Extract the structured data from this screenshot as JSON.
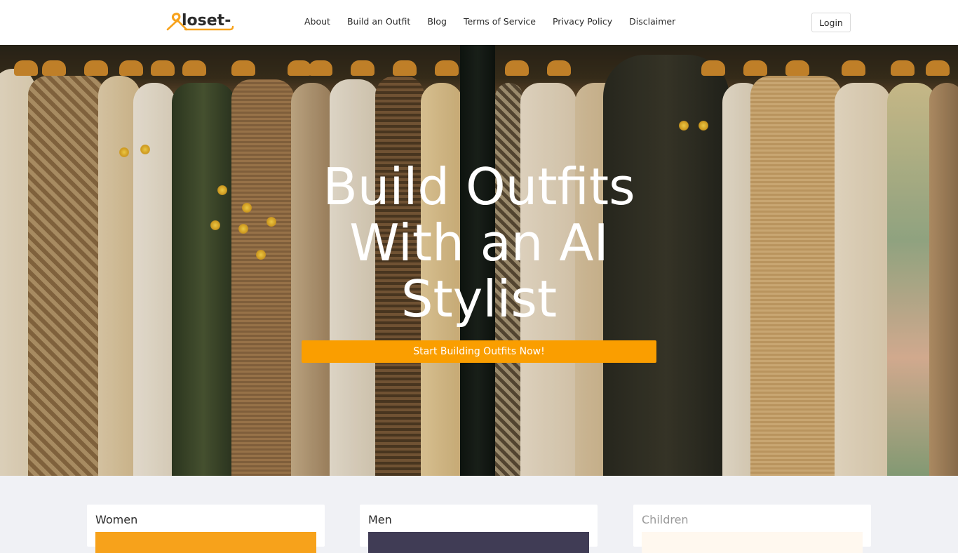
{
  "brand": {
    "logo_text": "loset-",
    "accent": "#f7a21b"
  },
  "nav": {
    "links": [
      {
        "label": "About"
      },
      {
        "label": "Build an Outfit"
      },
      {
        "label": "Blog"
      },
      {
        "label": "Terms of Service"
      },
      {
        "label": "Privacy Policy"
      },
      {
        "label": "Disclaimer"
      }
    ],
    "login_label": "Login"
  },
  "hero": {
    "title": "Build Outfits With an AI Stylist",
    "cta_label": "Start Building Outfits Now!",
    "cta_color": "#fa9e00",
    "background_image": "clothes-on-rack-photo"
  },
  "categories": [
    {
      "label": "Women",
      "color": "#f7a21b",
      "muted": false
    },
    {
      "label": "Men",
      "color": "#403c55",
      "muted": false
    },
    {
      "label": "Children",
      "color": "#fff8ef",
      "muted": true
    }
  ]
}
